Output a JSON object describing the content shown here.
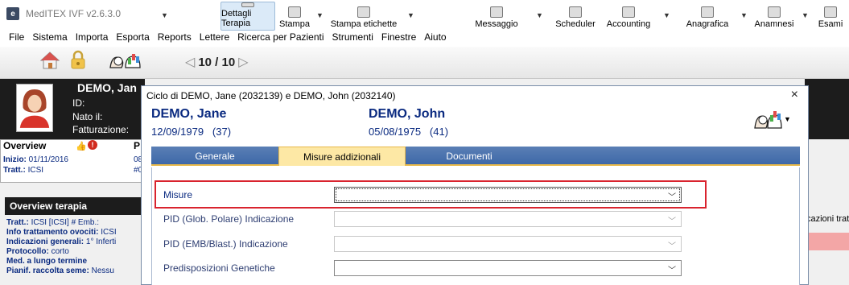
{
  "window": {
    "title": "MedITEX IVF v2.6.3.0",
    "app_icon_glyph": "e"
  },
  "menu": [
    "File",
    "Sistema",
    "Importa",
    "Esporta",
    "Reports",
    "Lettere",
    "Ricerca per Pazienti",
    "Strumenti",
    "Finestre",
    "Aiuto"
  ],
  "toolbar": {
    "counter": "10 / 10",
    "buttons": {
      "dettagli": "Dettagli Terapia",
      "stampa": "Stampa",
      "etichette": "Stampa etichette",
      "messaggio": "Messaggio",
      "scheduler": "Scheduler",
      "accounting": "Accounting",
      "anagrafica": "Anagrafica",
      "anamnesi": "Anamnesi",
      "esami": "Esami"
    }
  },
  "background": {
    "patient_name": "DEMO, Jan",
    "labels": {
      "id": "ID:",
      "nato": "Nato il:",
      "fatturazione": "Fatturazione:"
    },
    "overview": {
      "title": "Overview",
      "inizio_label": "Inizio:",
      "inizio_value": "01/11/2016",
      "tratt_label": "Tratt.:",
      "tratt_value": "ICSI",
      "p_letter": "P",
      "p_line1": "08",
      "p_line2": "#0"
    },
    "overview_terapia": {
      "title": "Overview terapia",
      "lines": [
        {
          "label": "Tratt.:",
          "value": "ICSI   [ICSI]   # Emb.:"
        },
        {
          "label": "Info trattamento ovociti:",
          "value": "ICSI"
        },
        {
          "label": "Indicazioni generali:",
          "value": "1° Inferti"
        },
        {
          "label": "Protocollo:",
          "value": "corto"
        },
        {
          "label": "Med. a lungo termine",
          "value": ""
        },
        {
          "label": "Pianif. raccolta seme:",
          "value": "Nessu"
        }
      ]
    },
    "right_text": "cazioni trat"
  },
  "dialog": {
    "title": "Ciclo di DEMO, Jane (2032139) e DEMO, John (2032140)",
    "close": "×",
    "patient1": {
      "name": "DEMO, Jane",
      "dob": "12/09/1979",
      "age": "(37)"
    },
    "patient2": {
      "name": "DEMO, John",
      "dob": "05/08/1975",
      "age": "(41)"
    },
    "tabs": [
      "Generale",
      "Misure addizionali",
      "Documenti"
    ],
    "active_tab": "Misure addizionali",
    "fields": [
      {
        "label": "Misure",
        "value": ""
      },
      {
        "label": "PID (Glob. Polare) Indicazione",
        "value": ""
      },
      {
        "label": "PID (EMB/Blast.) Indicazione",
        "value": ""
      },
      {
        "label": "Predisposizioni Genetiche",
        "value": ""
      }
    ]
  },
  "colors": {
    "accent": "#0a2a80",
    "highlight": "#d9232e",
    "tab_active": "#fde8a5",
    "tab_bar": "#4a72ae"
  }
}
